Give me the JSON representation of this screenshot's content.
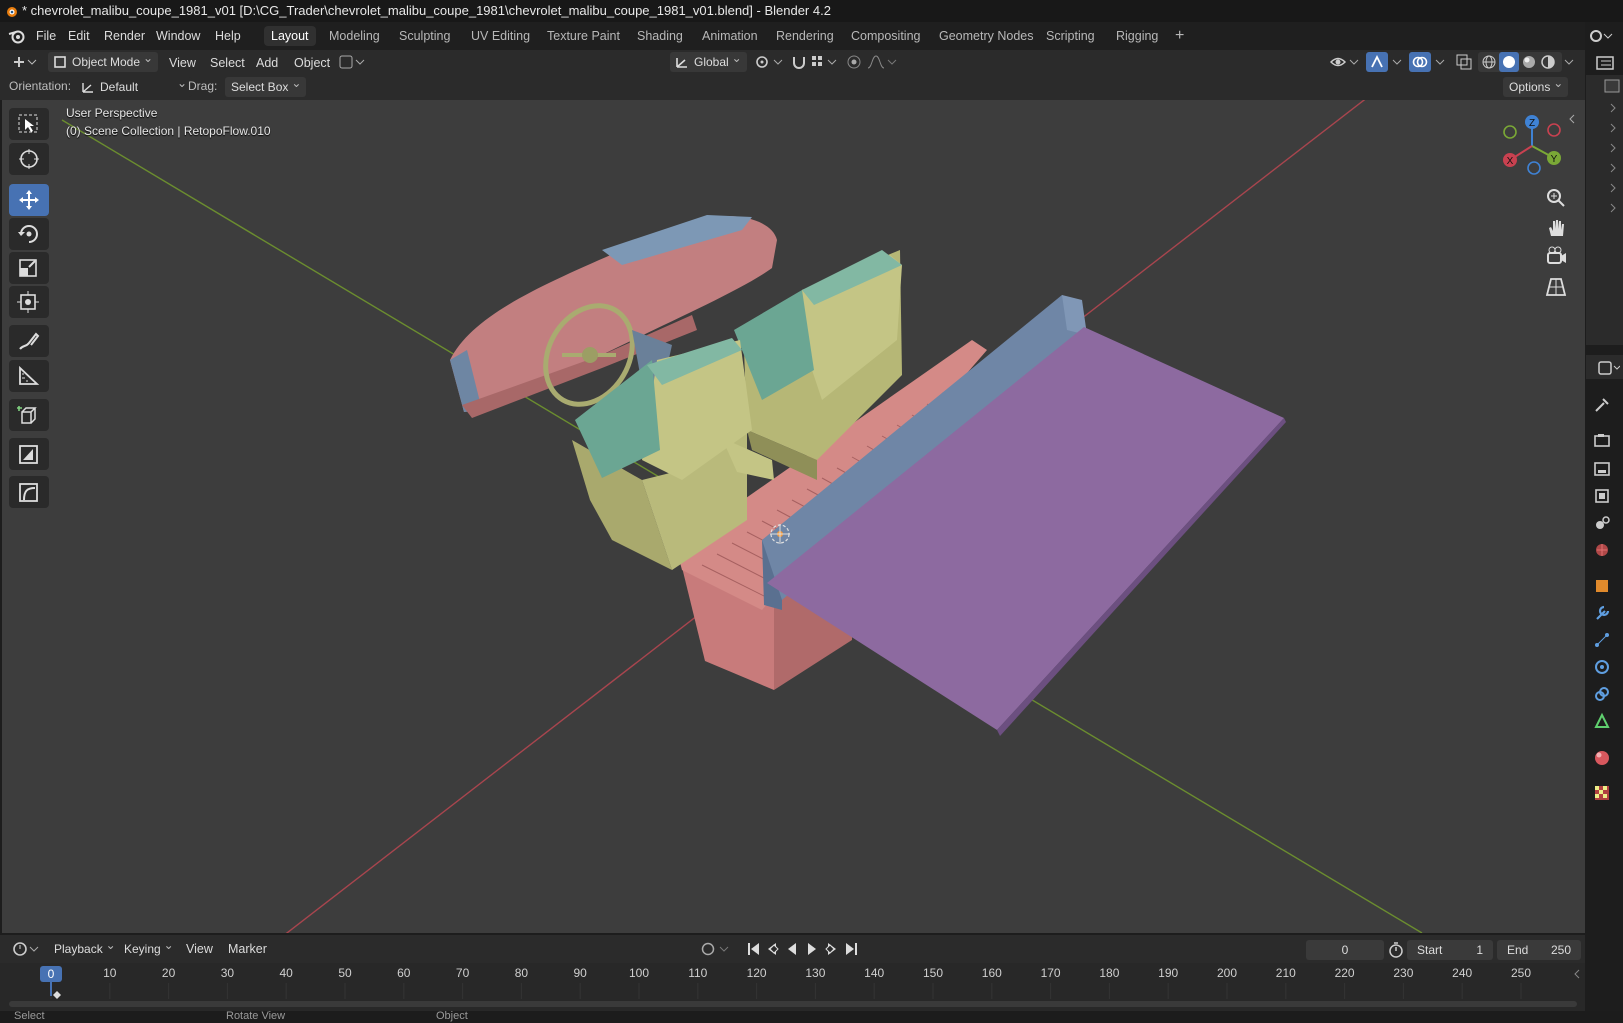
{
  "title_bar": {
    "title": "* chevrolet_malibu_coupe_1981_v01 [D:\\CG_Trader\\chevrolet_malibu_coupe_1981\\chevrolet_malibu_coupe_1981_v01.blend] - Blender 4.2"
  },
  "menu": [
    "File",
    "Edit",
    "Render",
    "Window",
    "Help"
  ],
  "workspaces": [
    "Layout",
    "Modeling",
    "Sculpting",
    "UV Editing",
    "Texture Paint",
    "Shading",
    "Animation",
    "Rendering",
    "Compositing",
    "Geometry Nodes",
    "Scripting",
    "Rigging"
  ],
  "active_workspace": "Layout",
  "header": {
    "mode": "Object Mode",
    "menus": [
      "View",
      "Select",
      "Add",
      "Object"
    ],
    "transform_orientation": "Global"
  },
  "tool_settings": {
    "orientation_label": "Orientation:",
    "orientation_value": "Default",
    "drag_label": "Drag:",
    "drag_value": "Select Box",
    "options": "Options"
  },
  "viewport": {
    "perspective": "User Perspective",
    "collection": "(0) Scene Collection | RetopoFlow.010",
    "gizmo_axes": [
      "X",
      "Y",
      "Z"
    ]
  },
  "tools": [
    "select-box-icon",
    "cursor-icon",
    "move-icon",
    "rotate-icon",
    "scale-icon",
    "transform-icon",
    "annotate-icon",
    "measure-icon",
    "add-cube-icon",
    "shrink-icon",
    "shear-icon"
  ],
  "colors": {
    "accent": "#4772b3",
    "x_axis": "#c94150",
    "y_axis": "#7aa836",
    "z_axis": "#3f82d4"
  },
  "timeline": {
    "menus": [
      "Playback",
      "Keying",
      "View",
      "Marker"
    ],
    "current_frame": "0",
    "start_label": "Start",
    "start_value": "1",
    "end_label": "End",
    "end_value": "250",
    "ticks": [
      "0",
      "10",
      "20",
      "30",
      "40",
      "50",
      "60",
      "70",
      "80",
      "90",
      "100",
      "110",
      "120",
      "130",
      "140",
      "150",
      "160",
      "170",
      "180",
      "190",
      "200",
      "210",
      "220",
      "230",
      "240",
      "250"
    ],
    "playhead": "0"
  },
  "status_bar": [
    "Select",
    "Rotate View",
    "Object"
  ]
}
